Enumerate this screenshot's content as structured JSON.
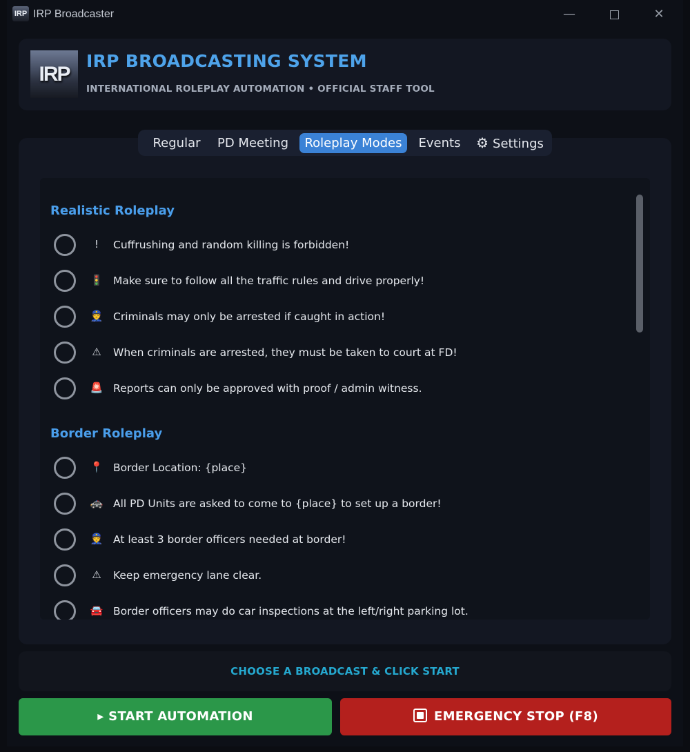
{
  "window": {
    "title": "IRP Broadcaster",
    "icon_label": "IRP",
    "controls": {
      "minimize": "—",
      "close": "✕"
    }
  },
  "header": {
    "logo_text": "IRP",
    "title": "IRP BROADCASTING SYSTEM",
    "subtitle": "INTERNATIONAL ROLEPLAY AUTOMATION • OFFICIAL STAFF TOOL"
  },
  "tabs": [
    {
      "label": "Regular",
      "active": false
    },
    {
      "label": "PD Meeting",
      "active": false
    },
    {
      "label": "Roleplay Modes",
      "active": true
    },
    {
      "label": "Events",
      "active": false
    },
    {
      "label": "Settings",
      "active": false,
      "icon": "gear-icon"
    }
  ],
  "sections": [
    {
      "title": "Realistic Roleplay",
      "items": [
        {
          "icon": "exclamation-icon",
          "glyph": "!",
          "text": "Cuffrushing and random killing is forbidden!",
          "selected": false
        },
        {
          "icon": "traffic-light-icon",
          "glyph": "🚦",
          "text": "Make sure to follow all the traffic rules and drive properly!",
          "selected": false
        },
        {
          "icon": "police-officer-icon",
          "glyph": "👮",
          "text": "Criminals may only be arrested if caught in action!",
          "selected": false
        },
        {
          "icon": "warning-icon",
          "glyph": "⚠",
          "text": "When criminals are arrested, they must be taken to court at FD!",
          "selected": false
        },
        {
          "icon": "siren-icon",
          "glyph": "🚨",
          "text": "Reports can only be approved with proof / admin witness.",
          "selected": false
        }
      ]
    },
    {
      "title": "Border Roleplay",
      "items": [
        {
          "icon": "pin-icon",
          "glyph": "📍",
          "text": "Border Location: {place}",
          "selected": false
        },
        {
          "icon": "police-car-icon",
          "glyph": "🚓",
          "text": "All PD Units are asked to come to {place} to set up a border!",
          "selected": false
        },
        {
          "icon": "police-officer-icon",
          "glyph": "👮",
          "text": "At least 3 border officers needed at border!",
          "selected": false
        },
        {
          "icon": "warning-icon",
          "glyph": "⚠",
          "text": "Keep emergency lane clear.",
          "selected": false
        },
        {
          "icon": "car-icon",
          "glyph": "🚘",
          "text": "Border officers may do car inspections at the left/right parking lot.",
          "selected": false
        }
      ]
    }
  ],
  "status_text": "CHOOSE A BROADCAST & CLICK START",
  "buttons": {
    "start": "▸ START AUTOMATION",
    "stop": "EMERGENCY STOP (F8)"
  },
  "colors": {
    "accent": "#3b82d6",
    "title_blue": "#4ea3ea",
    "status": "#25a8cf",
    "start": "#2b9749",
    "stop": "#b4201d"
  }
}
